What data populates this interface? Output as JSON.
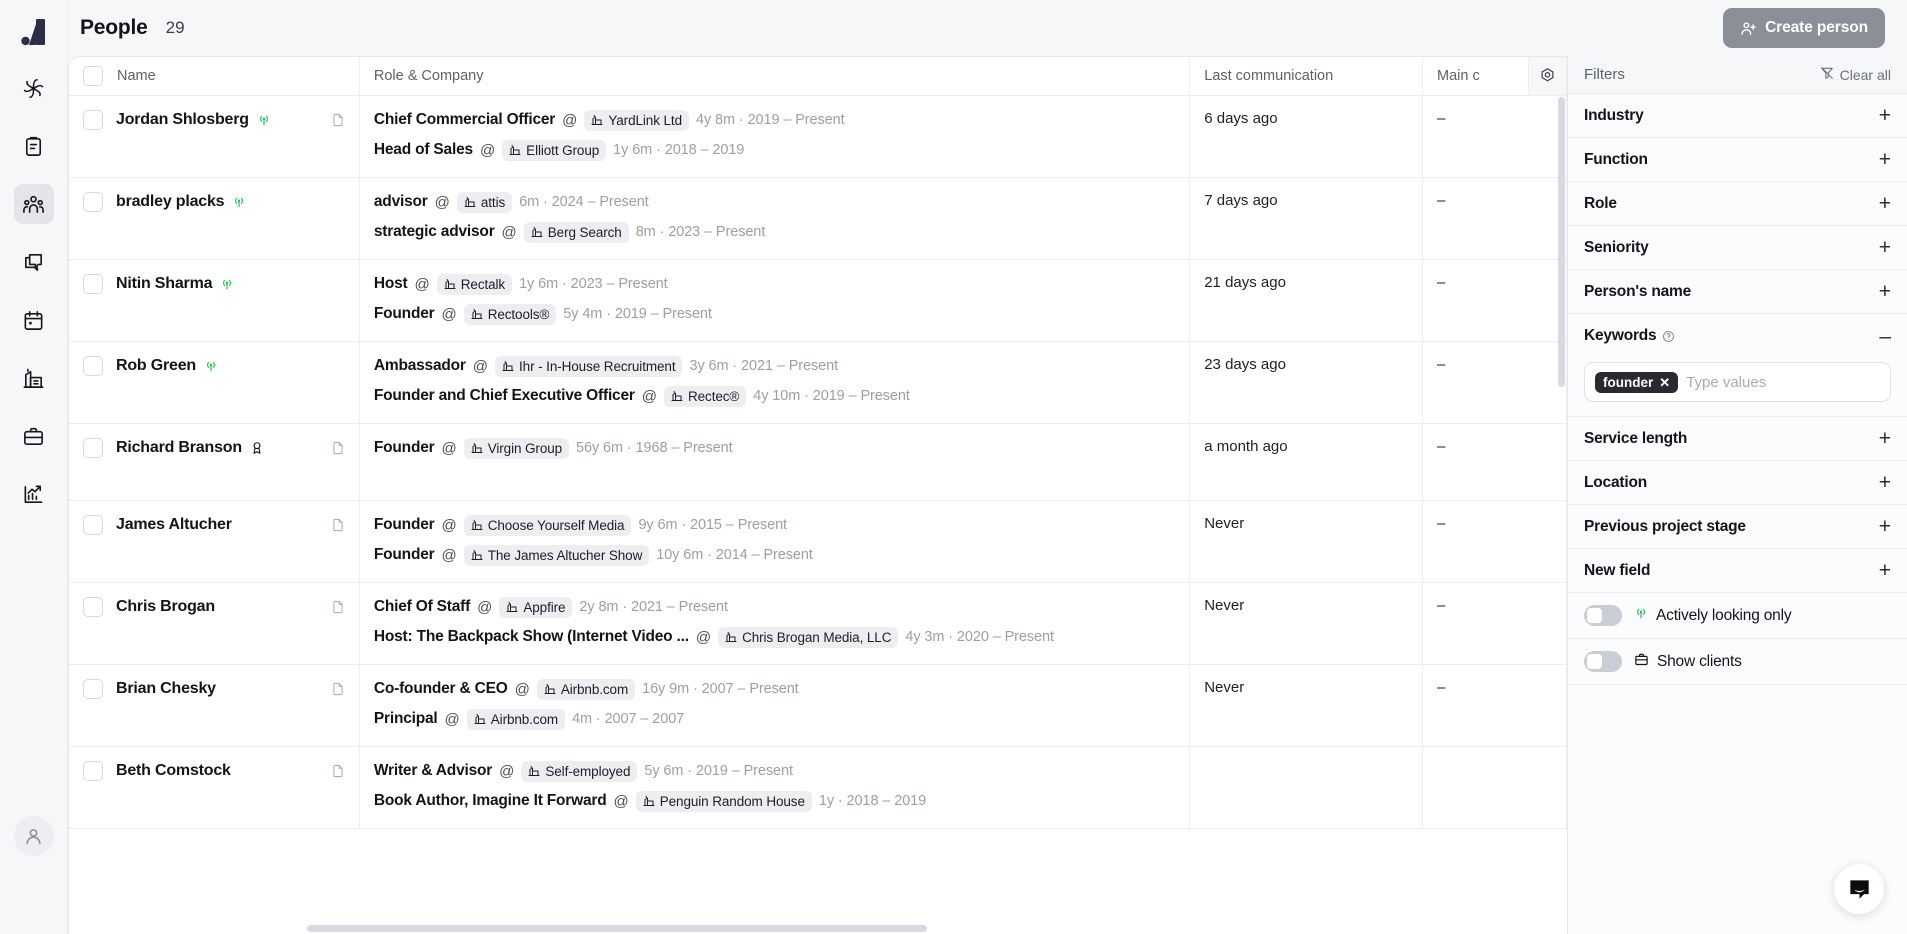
{
  "app": {
    "logo_icon": "logo-bar-icon",
    "rail_items": [
      {
        "icon": "sparkle-ai-icon",
        "name": "ai",
        "active": false
      },
      {
        "icon": "clipboard-icon",
        "name": "tasks",
        "active": false
      },
      {
        "icon": "people-icon",
        "name": "people",
        "active": true
      },
      {
        "icon": "chat-icon",
        "name": "messages",
        "active": false
      },
      {
        "icon": "calendar-icon",
        "name": "calendar",
        "active": false
      },
      {
        "icon": "company-icon",
        "name": "companies",
        "active": false
      },
      {
        "icon": "briefcase-icon",
        "name": "jobs",
        "active": false
      },
      {
        "icon": "analytics-icon",
        "name": "analytics",
        "active": false
      }
    ],
    "avatar_icon": "user-avatar-icon"
  },
  "header": {
    "title": "People",
    "count": "29",
    "create_label": "Create person",
    "create_icon": "add-person-icon"
  },
  "table": {
    "columns": [
      "Name",
      "Role & Company",
      "Last communication",
      "Main c"
    ],
    "gear_icon": "settings-gear-icon",
    "rows": [
      {
        "name": "Jordan Shlosberg",
        "badge": "signal",
        "has_doc": true,
        "roles": [
          {
            "title": "Chief Commercial Officer",
            "at": "@",
            "company": "YardLink Ltd",
            "meta": "4y 8m · 2019 – Present"
          },
          {
            "title": "Head of Sales",
            "at": "@",
            "company": "Elliott Group",
            "meta": "1y 6m · 2018 – 2019"
          }
        ],
        "last_communication": "6 days ago",
        "main_c": "–"
      },
      {
        "name": "bradley placks",
        "badge": "signal",
        "has_doc": false,
        "roles": [
          {
            "title": "advisor",
            "at": "@",
            "company": "attis",
            "meta": "6m · 2024 – Present"
          },
          {
            "title": "strategic advisor",
            "at": "@",
            "company": "Berg Search",
            "meta": "8m · 2023 – Present"
          }
        ],
        "last_communication": "7 days ago",
        "main_c": "–"
      },
      {
        "name": "Nitin Sharma",
        "badge": "signal",
        "has_doc": false,
        "roles": [
          {
            "title": "Host",
            "at": "@",
            "company": "Rectalk",
            "meta": "1y 6m · 2023 – Present"
          },
          {
            "title": "Founder",
            "at": "@",
            "company": "Rectools®",
            "meta": "5y 4m · 2019 – Present"
          }
        ],
        "last_communication": "21 days ago",
        "main_c": "–"
      },
      {
        "name": "Rob Green",
        "badge": "signal",
        "has_doc": false,
        "roles": [
          {
            "title": "Ambassador",
            "at": "@",
            "company": "Ihr - In-House Recruitment",
            "meta": "3y 6m · 2021 – Present"
          },
          {
            "title": "Founder and Chief Executive Officer",
            "at": "@",
            "company": "Rectec®",
            "meta": "4y 10m · 2019 – Present"
          }
        ],
        "last_communication": "23 days ago",
        "main_c": "–"
      },
      {
        "name": "Richard Branson",
        "badge": "award",
        "has_doc": true,
        "roles": [
          {
            "title": "Founder",
            "at": "@",
            "company": "Virgin Group",
            "meta": "56y 6m · 1968 – Present"
          }
        ],
        "last_communication": "a month ago",
        "main_c": "–"
      },
      {
        "name": "James Altucher",
        "badge": "none",
        "has_doc": true,
        "roles": [
          {
            "title": "Founder",
            "at": "@",
            "company": "Choose Yourself Media",
            "meta": "9y 6m · 2015 – Present"
          },
          {
            "title": "Founder",
            "at": "@",
            "company": "The James Altucher Show",
            "meta": "10y 6m · 2014 – Present"
          }
        ],
        "last_communication": "Never",
        "main_c": "–"
      },
      {
        "name": "Chris Brogan",
        "badge": "none",
        "has_doc": true,
        "roles": [
          {
            "title": "Chief Of Staff",
            "at": "@",
            "company": "Appfire",
            "meta": "2y 8m · 2021 – Present"
          },
          {
            "title": "Host: The Backpack Show (Internet Video ...",
            "at": "@",
            "company": "Chris Brogan Media, LLC",
            "meta": "4y 3m · 2020 – Present"
          }
        ],
        "last_communication": "Never",
        "main_c": "–"
      },
      {
        "name": "Brian Chesky",
        "badge": "none",
        "has_doc": true,
        "roles": [
          {
            "title": "Co-founder & CEO",
            "at": "@",
            "company": "Airbnb.com",
            "meta": "16y 9m · 2007 – Present"
          },
          {
            "title": "Principal",
            "at": "@",
            "company": "Airbnb.com",
            "meta": "4m · 2007 – 2007"
          }
        ],
        "last_communication": "Never",
        "main_c": "–"
      },
      {
        "name": "Beth Comstock",
        "badge": "none",
        "has_doc": true,
        "roles": [
          {
            "title": "Writer & Advisor",
            "at": "@",
            "company": "Self-employed",
            "meta": "5y 6m · 2019 – Present"
          },
          {
            "title": "Book Author, Imagine It Forward",
            "at": "@",
            "company": "Penguin Random House",
            "meta": "1y · 2018 – 2019"
          }
        ],
        "last_communication": "",
        "main_c": ""
      }
    ]
  },
  "filters": {
    "title": "Filters",
    "clear_all": "Clear all",
    "clear_icon": "filter-clear-icon",
    "sections": [
      {
        "label": "Industry",
        "state": "+"
      },
      {
        "label": "Function",
        "state": "+"
      },
      {
        "label": "Role",
        "state": "+"
      },
      {
        "label": "Seniority",
        "state": "+"
      },
      {
        "label": "Person's name",
        "state": "+"
      }
    ],
    "keywords": {
      "label": "Keywords",
      "state": "–",
      "help_icon": "help-circle-icon",
      "tags": [
        "founder"
      ],
      "placeholder": "Type values"
    },
    "sections_after": [
      {
        "label": "Service length",
        "state": "+"
      },
      {
        "label": "Location",
        "state": "+"
      },
      {
        "label": "Previous project stage",
        "state": "+"
      },
      {
        "label": "New field",
        "state": "+"
      }
    ],
    "toggles": [
      {
        "label": "Actively looking only",
        "icon": "signal-icon",
        "on": false
      },
      {
        "label": "Show clients",
        "icon": "briefcase-icon",
        "on": false
      }
    ]
  },
  "chat": {
    "icon": "chat-bubble-icon"
  },
  "colors": {
    "accent_green": "#22c55e",
    "create_button": "#8b9098",
    "tag_dark": "#272b31"
  }
}
